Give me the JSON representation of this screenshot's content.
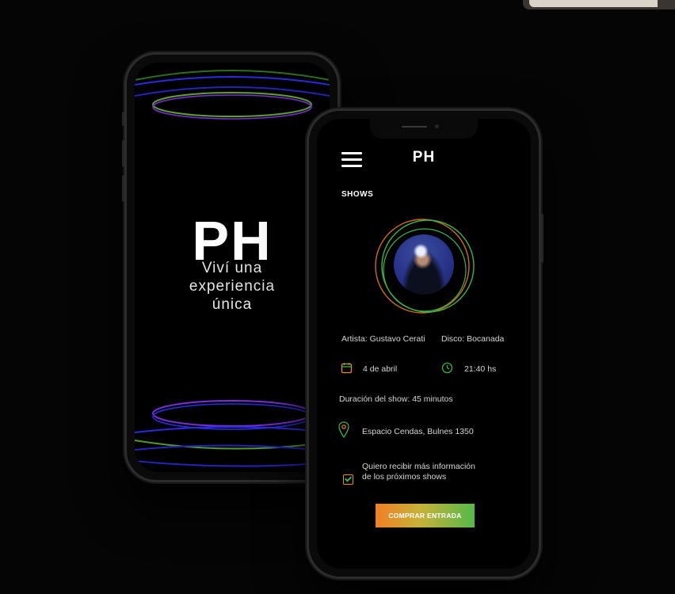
{
  "splash": {
    "logo": "PH",
    "tagline_line1": "Viví una",
    "tagline_line2": "experiencia",
    "tagline_line3": "única"
  },
  "app": {
    "logo": "PH",
    "section_title": "SHOWS",
    "artist": "Artista: Gustavo Cerati",
    "album": "Disco: Bocanada",
    "date": "4 de abril",
    "time": "21:40 hs",
    "duration": "Duración del show: 45 minutos",
    "location": "Espacio Cendas, Bulnes 1350",
    "newsletter_line1": "Quiero recibir más información",
    "newsletter_line2": "de los próximos shows",
    "cta_label": "COMPRAR ENTRADA"
  },
  "icons": {
    "menu": "hamburger-menu-icon",
    "calendar": "calendar-icon",
    "clock": "clock-icon",
    "location": "location-pin-icon",
    "checkbox": "checkbox-icon"
  },
  "colors": {
    "background": "#050505",
    "accent_orange": "#f07f24",
    "accent_green": "#55b948",
    "ring_blue": "#2a2ae0",
    "ring_purple": "#7a2fd8"
  }
}
